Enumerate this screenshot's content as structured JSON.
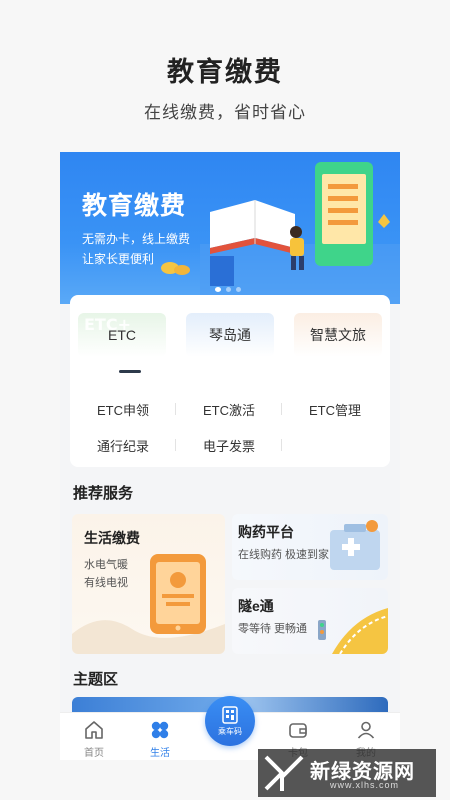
{
  "promo": {
    "title": "教育缴费",
    "subtitle": "在线缴费，省时省心"
  },
  "banner": {
    "title": "教育缴费",
    "line1": "无需办卡，线上缴费",
    "line2": "让家长更便利",
    "pages": 3,
    "active_page": 1
  },
  "top_tabs": [
    {
      "label": "ETC",
      "ghost": "ETC+",
      "active": true
    },
    {
      "label": "琴岛通",
      "ghost": "",
      "active": false
    },
    {
      "label": "智慧文旅",
      "ghost": "",
      "active": false
    }
  ],
  "sub_items": {
    "row1": [
      "ETC申领",
      "ETC激活",
      "ETC管理"
    ],
    "row2": [
      "通行纪录",
      "电子发票"
    ]
  },
  "sections": {
    "recommended": "推荐服务",
    "theme": "主题区"
  },
  "services": {
    "big": {
      "name": "生活缴费",
      "desc1": "水电气暖",
      "desc2": "有线电视"
    },
    "small": [
      {
        "name": "购药平台",
        "desc": "在线购药 极速到家"
      },
      {
        "name": "隧e通",
        "desc": "零等待 更畅通"
      }
    ]
  },
  "tabbar": {
    "items": [
      {
        "label": "首页",
        "icon": "home-icon"
      },
      {
        "label": "生活",
        "icon": "clover-icon",
        "active": true
      },
      {
        "label": "卡包",
        "icon": "wallet-icon"
      },
      {
        "label": "我的",
        "icon": "user-icon"
      }
    ],
    "center": {
      "label": "乘车码",
      "icon": "qr-code-icon"
    }
  },
  "watermark": {
    "title": "新绿资源网",
    "url": "www.xlhs.com"
  },
  "colors": {
    "accent": "#2f7fe8",
    "banner_blue": "#2f86f2",
    "orange": "#f39a3c"
  }
}
